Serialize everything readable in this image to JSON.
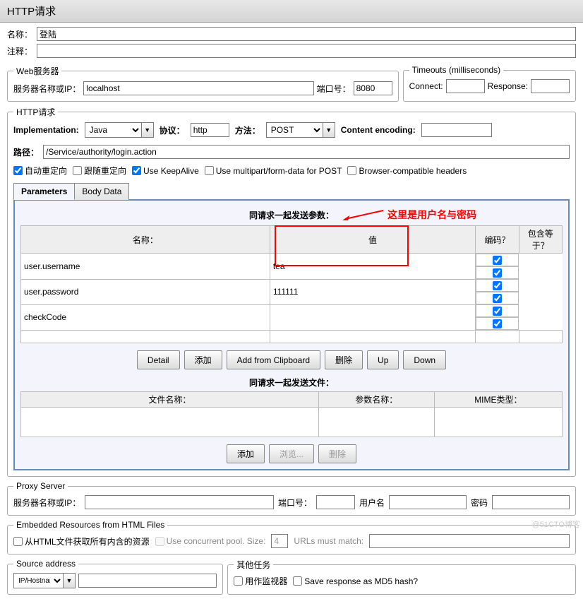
{
  "title": "HTTP请求",
  "basic": {
    "name_label": "名称：",
    "name_value": "登陆",
    "comment_label": "注释：",
    "comment_value": ""
  },
  "web_server": {
    "legend": "Web服务器",
    "host_label": "服务器名称或IP：",
    "host_value": "localhost",
    "port_label": "端口号：",
    "port_value": "8080"
  },
  "timeouts": {
    "legend": "Timeouts (milliseconds)",
    "connect_label": "Connect:",
    "connect_value": "",
    "response_label": "Response:",
    "response_value": ""
  },
  "http": {
    "legend": "HTTP请求",
    "impl_label": "Implementation:",
    "impl_value": "Java",
    "protocol_label": "协议：",
    "protocol_value": "http",
    "method_label": "方法：",
    "method_value": "POST",
    "encoding_label": "Content encoding:",
    "encoding_value": "",
    "path_label": "路径：",
    "path_value": "/Service/authority/login.action",
    "checks": {
      "auto_redirect": "自动重定向",
      "follow_redirect": "跟随重定向",
      "keepalive": "Use KeepAlive",
      "multipart": "Use multipart/form-data for POST",
      "browser_compat": "Browser-compatible headers"
    }
  },
  "tabs": {
    "parameters": "Parameters",
    "body_data": "Body Data"
  },
  "params_section": {
    "title": "同请求一起发送参数：",
    "annotation": "这里是用户名与密码",
    "headers": {
      "name": "名称：",
      "value": "值",
      "encode": "编码？",
      "include_equals": "包含等于？"
    },
    "rows": [
      {
        "name": "user.username",
        "value": "tea",
        "encode": true,
        "eq": true
      },
      {
        "name": "user.password",
        "value": "111111",
        "encode": true,
        "eq": true
      },
      {
        "name": "checkCode",
        "value": "",
        "encode": true,
        "eq": true
      }
    ],
    "buttons": {
      "detail": "Detail",
      "add": "添加",
      "clipboard": "Add from Clipboard",
      "delete": "删除",
      "up": "Up",
      "down": "Down"
    }
  },
  "files_section": {
    "title": "同请求一起发送文件：",
    "headers": {
      "filename": "文件名称：",
      "param_name": "参数名称：",
      "mime": "MIME类型："
    },
    "buttons": {
      "add": "添加",
      "browse": "浏览...",
      "delete": "删除"
    }
  },
  "proxy": {
    "legend": "Proxy Server",
    "host_label": "服务器名称或IP：",
    "port_label": "端口号：",
    "user_label": "用户名",
    "pass_label": "密码"
  },
  "embedded": {
    "legend": "Embedded Resources from HTML Files",
    "retrieve": "从HTML文件获取所有内含的资源",
    "pool_label": "Use concurrent pool. Size:",
    "pool_value": "4",
    "match_label": "URLs must match:"
  },
  "source_address": {
    "legend": "Source address",
    "type": "IP/Hostname"
  },
  "other_tasks": {
    "legend": "其他任务",
    "monitor": "用作监视器",
    "md5": "Save response as MD5 hash?"
  },
  "watermark": "@51CTO博客"
}
